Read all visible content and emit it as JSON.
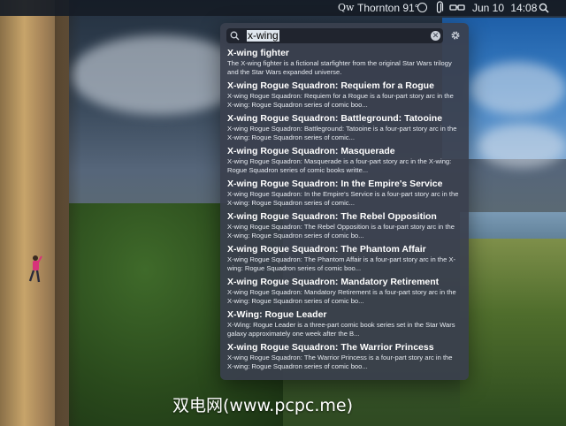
{
  "menubar": {
    "qw_label": "Qw",
    "weather": "Thornton 91°",
    "date": "Jun 10",
    "time": "14:08",
    "icons": [
      "circle-icon",
      "paperclip-icon",
      "glasses-icon",
      "search-icon"
    ]
  },
  "spotlight": {
    "query": "x-wing",
    "results": [
      {
        "title": "X-wing fighter",
        "desc": "The X-wing fighter is a fictional starfighter from the original Star Wars trilogy and the Star Wars expanded universe."
      },
      {
        "title": "X-wing Rogue Squadron: Requiem for a Rogue",
        "desc": "X-wing Rogue Squadron: Requiem for a Rogue is a four-part story arc in the X-wing: Rogue Squadron series of comic boo..."
      },
      {
        "title": "X-wing Rogue Squadron: Battleground: Tatooine",
        "desc": "X-wing Rogue Squadron: Battleground: Tatooine is a four-part story arc in the X-wing: Rogue Squadron series of comic..."
      },
      {
        "title": "X-wing Rogue Squadron: Masquerade",
        "desc": "X-wing Rogue Squadron: Masquerade is a four-part story arc in the X-wing: Rogue Squadron series of comic books writte..."
      },
      {
        "title": "X-wing Rogue Squadron: In the Empire's Service",
        "desc": "X-wing Rogue Squadron: In the Empire's Service is a four-part story arc in the X-wing: Rogue Squadron series of comic..."
      },
      {
        "title": "X-wing Rogue Squadron: The Rebel Opposition",
        "desc": "X-wing Rogue Squadron: The Rebel Opposition is a four-part story arc in the X-wing: Rogue Squadron series of comic bo..."
      },
      {
        "title": "X-wing Rogue Squadron: The Phantom Affair",
        "desc": "X-wing Rogue Squadron: The Phantom Affair is a four-part story arc in the X-wing: Rogue Squadron series of comic boo..."
      },
      {
        "title": "X-wing Rogue Squadron: Mandatory Retirement",
        "desc": "X-wing Rogue Squadron: Mandatory Retirement is a four-part story arc in the X-wing: Rogue Squadron series of comic bo..."
      },
      {
        "title": "X-Wing: Rogue Leader",
        "desc": "X-Wing: Rogue Leader is a three-part comic book series set in the Star Wars galaxy approximately one week after the B..."
      },
      {
        "title": "X-wing Rogue Squadron: The Warrior Princess",
        "desc": "X-wing Rogue Squadron: The Warrior Princess is a four-part story arc in the X-wing: Rogue Squadron series of comic boo..."
      }
    ]
  },
  "watermark": "双电网(www.pcpc.me)",
  "colors": {
    "panel_bg": "#3a404e",
    "menubar_bg": "#161c26",
    "selection": "#dfe6ee"
  }
}
